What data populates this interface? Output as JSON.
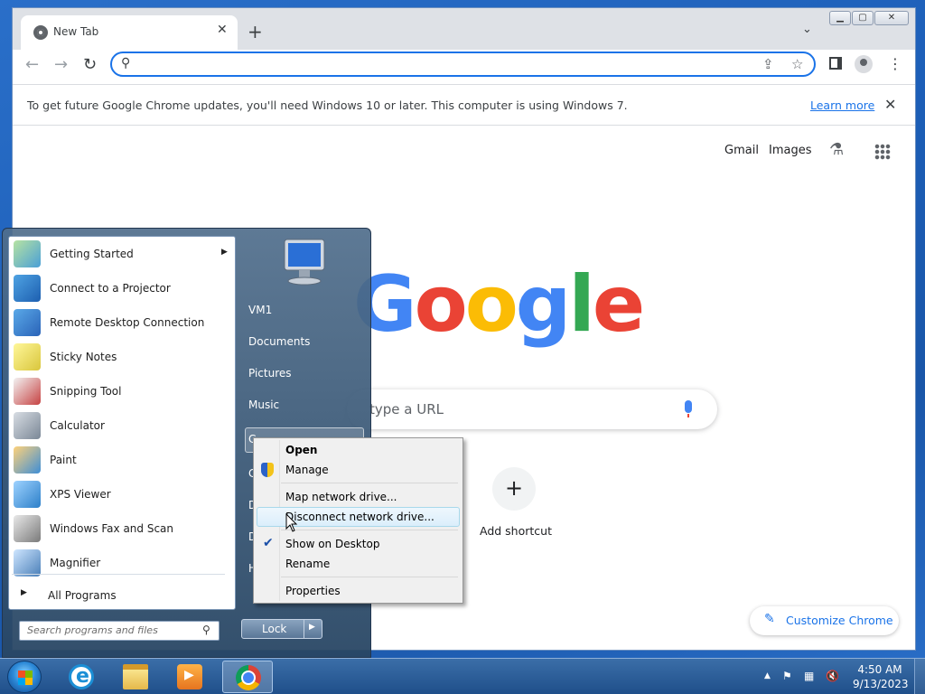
{
  "browser": {
    "tab_title": "New Tab",
    "tab_close": "✕",
    "new_tab": "+",
    "tab_menu": "⌄",
    "window_min": "▁",
    "window_max": "▢",
    "window_close": "✕",
    "nav_back": "←",
    "nav_forward": "→",
    "nav_reload": "↻",
    "omnibox_value": "",
    "infobar": {
      "message": "To get future Google Chrome updates, you'll need Windows 10 or later. This computer is using Windows 7.",
      "learn_more": "Learn more",
      "close": "✕"
    }
  },
  "ntp": {
    "gmail": "Gmail",
    "images": "Images",
    "logo": [
      "G",
      "o",
      "o",
      "g",
      "l",
      "e"
    ],
    "logo_colors": [
      "#4285f4",
      "#ea4335",
      "#fbbc05",
      "#4285f4",
      "#34a853",
      "#ea4335"
    ],
    "search_placeholder": "type a URL",
    "add_shortcut_symbol": "+",
    "add_shortcut": "Add shortcut",
    "customize": "Customize Chrome"
  },
  "start_menu": {
    "programs": [
      {
        "label": "Getting Started",
        "icon": "getting-started-icon",
        "has_submenu": true
      },
      {
        "label": "Connect to a Projector",
        "icon": "projector-icon"
      },
      {
        "label": "Remote Desktop Connection",
        "icon": "remote-desktop-icon"
      },
      {
        "label": "Sticky Notes",
        "icon": "sticky-notes-icon"
      },
      {
        "label": "Snipping Tool",
        "icon": "snipping-tool-icon"
      },
      {
        "label": "Calculator",
        "icon": "calculator-icon"
      },
      {
        "label": "Paint",
        "icon": "paint-icon"
      },
      {
        "label": "XPS Viewer",
        "icon": "xps-viewer-icon"
      },
      {
        "label": "Windows Fax and Scan",
        "icon": "fax-scan-icon"
      },
      {
        "label": "Magnifier",
        "icon": "magnifier-icon"
      }
    ],
    "all_programs": "All Programs",
    "search_placeholder": "Search programs and files",
    "right_links": [
      "VM1",
      "Documents",
      "Pictures",
      "Music"
    ],
    "right_partial": [
      "C",
      "C",
      "D",
      "D",
      "H"
    ],
    "lock": "Lock"
  },
  "context_menu": {
    "items": [
      {
        "label": "Open",
        "bold": true
      },
      {
        "label": "Manage",
        "icon": "uac-shield-icon"
      },
      {
        "label": "Map network drive..."
      },
      {
        "label": "Disconnect network drive...",
        "hover": true
      },
      {
        "label": "Show on Desktop",
        "checked": true
      },
      {
        "label": "Rename"
      },
      {
        "label": "Properties"
      }
    ]
  },
  "taskbar": {
    "time": "4:50 AM",
    "date": "9/13/2023",
    "tray_icons": [
      "show-hidden-icon",
      "action-center-flag-icon",
      "network-icon",
      "volume-muted-icon"
    ]
  },
  "colors": {
    "accent": "#1a73e8",
    "taskbar": "#1f4f8a"
  }
}
